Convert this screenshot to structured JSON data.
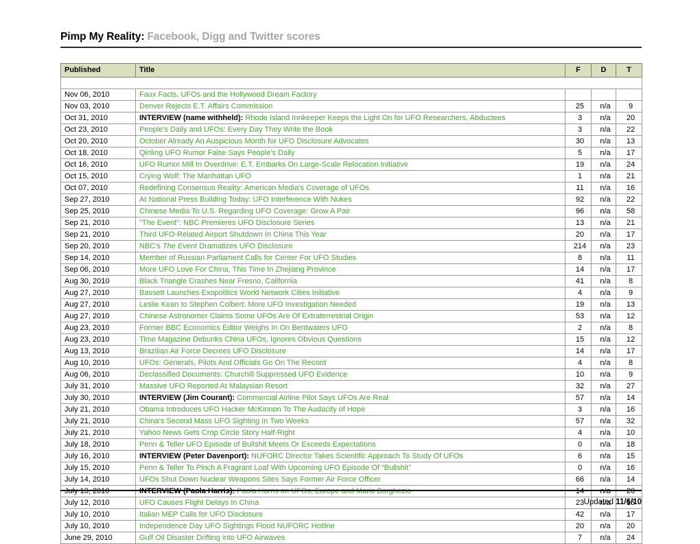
{
  "header": {
    "title_main": "Pimp My Reality:",
    "title_sub": "Facebook, Digg and Twitter scores"
  },
  "table": {
    "columns": {
      "published": "Published",
      "title": "Title",
      "f": "F",
      "d": "D",
      "t": "T"
    },
    "rows": [
      {
        "published": "Nov 06, 2010",
        "prefix": "",
        "title": "Faux Facts, UFOs and the Hollywood Dream Factory",
        "f": "",
        "d": "",
        "t": ""
      },
      {
        "published": "Nov 03, 2010",
        "prefix": "",
        "title": "Denver Rejects E.T. Affairs Commission",
        "f": "25",
        "d": "n/a",
        "t": "9"
      },
      {
        "published": "Oct 31, 2010",
        "prefix": "INTERVIEW (name withheld):",
        "title": "Rhode Island Innkeeper Keeps the Light On for UFO Researchers, Abductees",
        "f": "3",
        "d": "n/a",
        "t": "20"
      },
      {
        "published": "Oct 23, 2010",
        "prefix": "",
        "title": "People’s Daily and UFOs: Every Day They Write the Book",
        "f": "3",
        "d": "n/a",
        "t": "22"
      },
      {
        "published": "Oct 20, 2010",
        "prefix": "",
        "title": "October Already An Auspicious Month for UFO Disclosure Advocates",
        "f": "30",
        "d": "n/a",
        "t": "13"
      },
      {
        "published": "Oct 18, 2010",
        "prefix": "",
        "title": "Qinling UFO Rumor False Says People's Daily",
        "f": "5",
        "d": "n/a",
        "t": "17"
      },
      {
        "published": "Oct 16, 2010",
        "prefix": "",
        "title": "UFO Rumor Mill In Overdrive: E.T. Embarks On Large-Scale Relocation Initiative",
        "f": "19",
        "d": "n/a",
        "t": "24"
      },
      {
        "published": "Oct 15, 2010",
        "prefix": "",
        "title": "Crying Wolf: The Manhattan UFO",
        "f": "1",
        "d": "n/a",
        "t": "21"
      },
      {
        "published": "Oct 07, 2010",
        "prefix": "",
        "title": "Redefining Consensus Reality: American Media's Coverage of UFOs",
        "f": "11",
        "d": "n/a",
        "t": "16"
      },
      {
        "published": "Sep 27, 2010",
        "prefix": "",
        "title": "At National Press Building Today: UFO Interference With Nukes",
        "f": "92",
        "d": "n/a",
        "t": "22"
      },
      {
        "published": "Sep 25, 2010",
        "prefix": "",
        "title": "Chinese Media To U.S. Regarding UFO Coverage: Grow A Pair",
        "f": "96",
        "d": "n/a",
        "t": "58"
      },
      {
        "published": "Sep 21, 2010",
        "prefix": "",
        "title": "\"The Event\": NBC Premieres UFO Disclosure Series",
        "f": "13",
        "d": "n/a",
        "t": "21"
      },
      {
        "published": "Sep 21, 2010",
        "prefix": "",
        "title": "Third UFO-Related Airport Shutdown In China This Year",
        "f": "20",
        "d": "n/a",
        "t": "17"
      },
      {
        "published": "Sep 20, 2010",
        "prefix": "",
        "title": "NBC's ",
        "title_italic": "The Event",
        "title_after": " Dramatizes UFO Disclosure",
        "f": "214",
        "d": "n/a",
        "t": "23"
      },
      {
        "published": "Sep 14, 2010",
        "prefix": "",
        "title": "Member of Russian Parliament Calls for Center For UFO Studies",
        "f": "8",
        "d": "n/a",
        "t": "11"
      },
      {
        "published": "Sep 06, 2010",
        "prefix": "",
        "title": "More UFO Love For China, This Time In Zhejiang Province",
        "f": "14",
        "d": "n/a",
        "t": "17"
      },
      {
        "published": "Aug 30, 2010",
        "prefix": "",
        "title": "Black Triangle Crashes Near Fresno, California",
        "f": "41",
        "d": "n/a",
        "t": "8"
      },
      {
        "published": "Aug 27, 2010",
        "prefix": "",
        "title": "Bassett Launches Exopolitics World Network Cities Initiative",
        "f": "4",
        "d": "n/a",
        "t": "9"
      },
      {
        "published": "Aug 27, 2010",
        "prefix": "",
        "title": "Leslie Kean to Stephen Colbert: More UFO Investigation Needed",
        "f": "19",
        "d": "n/a",
        "t": "13"
      },
      {
        "published": "Aug 27, 2010",
        "prefix": "",
        "title": "Chinese Astronomer Claims Some UFOs Are Of Extraterrestrial Origin",
        "f": "53",
        "d": "n/a",
        "t": "12"
      },
      {
        "published": "Aug 23, 2010",
        "prefix": "",
        "title": "Former BBC Economics Editor Weighs In On Bentwaters UFO",
        "f": "2",
        "d": "n/a",
        "t": "8"
      },
      {
        "published": "Aug 23, 2010",
        "prefix": "",
        "title": "Time Magazine Debunks China UFOs, Ignores Obvious Questions",
        "f": "15",
        "d": "n/a",
        "t": "12"
      },
      {
        "published": "Aug 13, 2010",
        "prefix": "",
        "title": "Brazilian Air Force Decrees UFO Disclosure",
        "f": "14",
        "d": "n/a",
        "t": "17"
      },
      {
        "published": "Aug 10, 2010",
        "prefix": "",
        "title": "UFOs: Generals, Pilots And Officials Go On The Record",
        "f": "4",
        "d": "n/a",
        "t": "8"
      },
      {
        "published": "Aug 06, 2010",
        "prefix": "",
        "title": "Declassified Documents: Churchill Suppressed UFO Evidence",
        "f": "10",
        "d": "n/a",
        "t": "9"
      },
      {
        "published": "July 31, 2010",
        "prefix": "",
        "title": "Massive UFO Reported At Malaysian Resort",
        "f": "32",
        "d": "n/a",
        "t": "27"
      },
      {
        "published": "July 30, 2010",
        "prefix": "INTERVIEW (Jim Courant):",
        "title": "Commercial Airline Pilot Says UFOs Are Real",
        "f": "57",
        "d": "n/a",
        "t": "14"
      },
      {
        "published": "July 21, 2010",
        "prefix": "",
        "title": "Obama Introduces UFO Hacker McKinnon To The Audacity of Hope",
        "f": "3",
        "d": "n/a",
        "t": "16"
      },
      {
        "published": "July 21, 2010",
        "prefix": "",
        "title": "China's Second Mass UFO Sighting In Two Weeks",
        "f": "57",
        "d": "n/a",
        "t": "32"
      },
      {
        "published": "July 21, 2010",
        "prefix": "",
        "title": "Yahoo News Gets Crop Circle Story Half-Right",
        "f": "4",
        "d": "n/a",
        "t": "10"
      },
      {
        "published": "July 18, 2010",
        "prefix": "",
        "title": "Penn & Teller UFO Episode of Bullshit Meets Or Exceeds Expectations",
        "f": "0",
        "d": "n/a",
        "t": "18"
      },
      {
        "published": "July 16, 2010",
        "prefix": "INTERVIEW (Peter Davenport):",
        "title": "NUFORC Director Takes Scientific Approach To Study Of UFOs",
        "f": "6",
        "d": "n/a",
        "t": "15"
      },
      {
        "published": "July 15, 2010",
        "prefix": "",
        "title": "Penn & Teller To Pinch A Fragrant Loaf With Upcoming UFO Episode Of “Bullshit”",
        "f": "0",
        "d": "n/a",
        "t": "16"
      },
      {
        "published": "July 14, 2010",
        "prefix": "",
        "title": "UFOs Shut Down Nuclear Weapons Sites Says Former Air Force Officer",
        "f": "66",
        "d": "n/a",
        "t": "14"
      },
      {
        "published": "July 13, 2010",
        "prefix": "INTERVIEW (Paola Harris):",
        "title": "Paola Harris on UFOs, Europe and Mario Borghezio",
        "f": "14",
        "d": "n/a",
        "t": "20"
      },
      {
        "published": "July 12, 2010",
        "prefix": "",
        "title": "UFO Causes Flight Delays In China",
        "f": "23",
        "d": "n/a",
        "t": "15"
      },
      {
        "published": "July 10, 2010",
        "prefix": "",
        "title": "Italian MEP Calls for UFO Disclosure",
        "f": "42",
        "d": "n/a",
        "t": "17"
      },
      {
        "published": "July 10, 2010",
        "prefix": "",
        "title": "Independence Day UFO Sightings Flood NUFORC Hotline",
        "f": "20",
        "d": "n/a",
        "t": "20"
      },
      {
        "published": "June 29, 2010",
        "prefix": "",
        "title": "Gulf Oil Disaster Drifting into UFO Airwaves",
        "f": "7",
        "d": "n/a",
        "t": "24"
      }
    ]
  },
  "footer": {
    "updated_label": "Updated",
    "updated_date": "11/6/10"
  },
  "colors": {
    "header_fill": "#d9e0bd",
    "title_green": "#4ca23a",
    "subtitle_gray": "#a6a6a6",
    "grid_line": "#9a9a9a"
  }
}
